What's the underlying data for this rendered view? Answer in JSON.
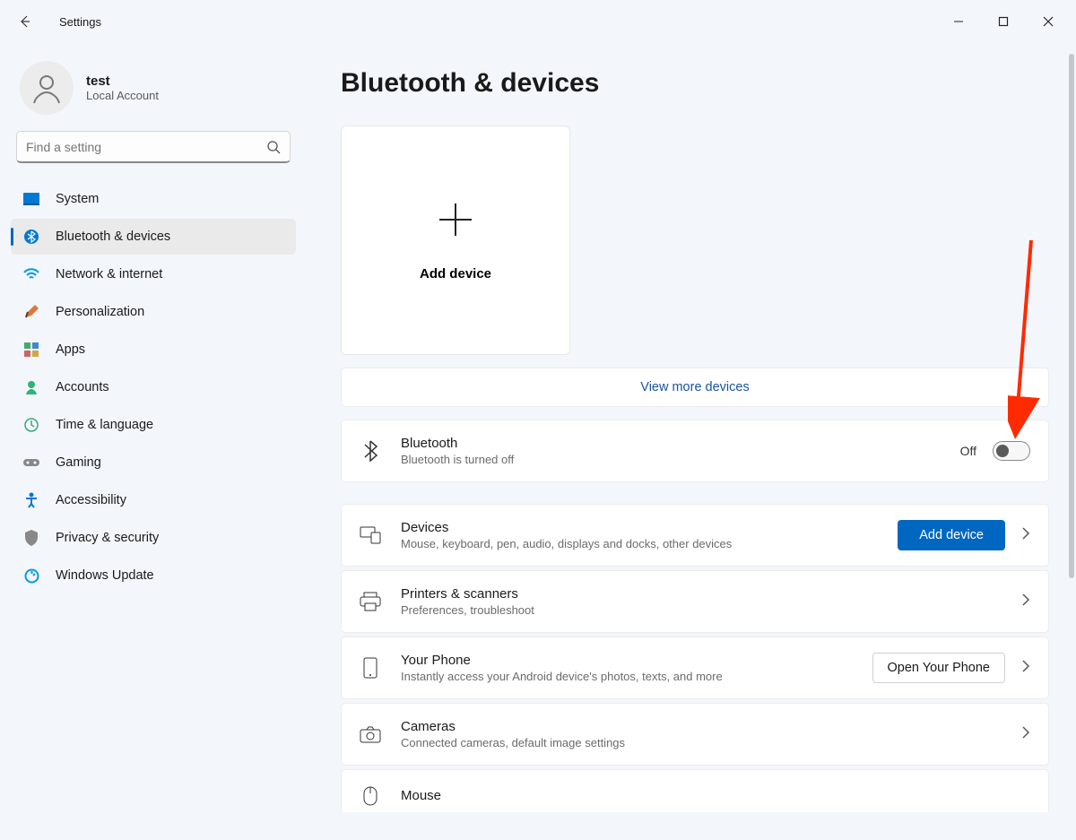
{
  "window": {
    "title": "Settings"
  },
  "account": {
    "name": "test",
    "sub": "Local Account"
  },
  "search": {
    "placeholder": "Find a setting"
  },
  "nav": {
    "items": [
      {
        "label": "System"
      },
      {
        "label": "Bluetooth & devices"
      },
      {
        "label": "Network & internet"
      },
      {
        "label": "Personalization"
      },
      {
        "label": "Apps"
      },
      {
        "label": "Accounts"
      },
      {
        "label": "Time & language"
      },
      {
        "label": "Gaming"
      },
      {
        "label": "Accessibility"
      },
      {
        "label": "Privacy & security"
      },
      {
        "label": "Windows Update"
      }
    ]
  },
  "page": {
    "title": "Bluetooth & devices",
    "add_device_card": "Add device",
    "view_more": "View more devices",
    "bluetooth": {
      "title": "Bluetooth",
      "sub": "Bluetooth is turned off",
      "state": "Off"
    },
    "devices": {
      "title": "Devices",
      "sub": "Mouse, keyboard, pen, audio, displays and docks, other devices",
      "button": "Add device"
    },
    "printers": {
      "title": "Printers & scanners",
      "sub": "Preferences, troubleshoot"
    },
    "phone": {
      "title": "Your Phone",
      "sub": "Instantly access your Android device's photos, texts, and more",
      "button": "Open Your Phone"
    },
    "cameras": {
      "title": "Cameras",
      "sub": "Connected cameras, default image settings"
    },
    "mouse": {
      "title": "Mouse"
    }
  }
}
